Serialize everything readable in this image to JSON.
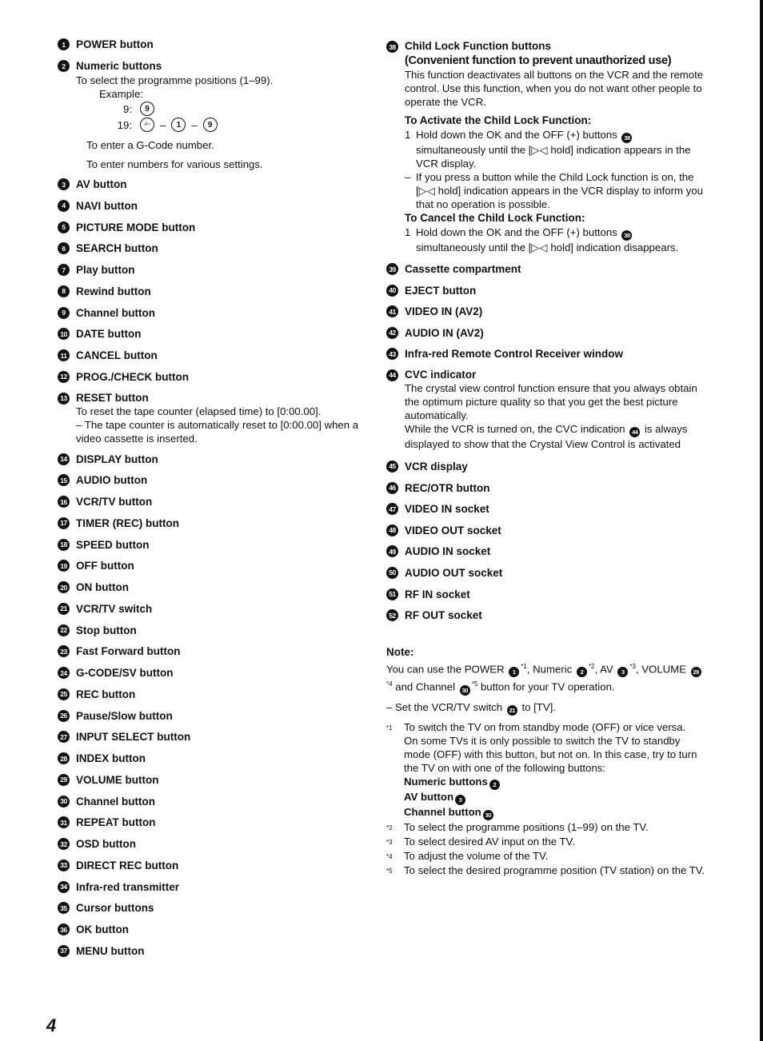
{
  "page_number": "4",
  "left_column": {
    "items_top": [
      {
        "num": "1",
        "label": "POWER button"
      },
      {
        "num": "2",
        "label": "Numeric buttons",
        "desc": "To select the programme positions (1–99).",
        "example_label": "Example:",
        "examples": [
          {
            "key": "9:",
            "sequence": [
              "9"
            ]
          },
          {
            "key": "19:",
            "sequence": [
              "-/--",
              "1",
              "9"
            ]
          }
        ],
        "extra": [
          "To enter a G-Code number.",
          "To enter numbers for various settings."
        ]
      }
    ],
    "items_mid": [
      {
        "num": "3",
        "label": "AV button"
      },
      {
        "num": "4",
        "label": "NAVI button"
      },
      {
        "num": "5",
        "label": "PICTURE MODE button"
      },
      {
        "num": "6",
        "label": "SEARCH button"
      },
      {
        "num": "7",
        "label": "Play button"
      },
      {
        "num": "8",
        "label": "Rewind button"
      },
      {
        "num": "9",
        "label": "Channel button"
      },
      {
        "num": "10",
        "label": "DATE button"
      },
      {
        "num": "11",
        "label": "CANCEL button"
      },
      {
        "num": "12",
        "label": "PROG./CHECK button"
      }
    ],
    "reset": {
      "num": "13",
      "label": "RESET button",
      "desc": "To reset the tape counter (elapsed time) to [0:00.00].",
      "note": "– The tape counter is automatically reset to [0:00.00] when a video cassette is inserted."
    },
    "items_bottom": [
      {
        "num": "14",
        "label": "DISPLAY button"
      },
      {
        "num": "15",
        "label": "AUDIO button"
      },
      {
        "num": "16",
        "label": "VCR/TV button"
      },
      {
        "num": "17",
        "label": "TIMER (REC) button"
      },
      {
        "num": "18",
        "label": "SPEED button"
      },
      {
        "num": "19",
        "label": "OFF button"
      },
      {
        "num": "20",
        "label": "ON button"
      },
      {
        "num": "21",
        "label": "VCR/TV switch"
      },
      {
        "num": "22",
        "label": "Stop button"
      },
      {
        "num": "23",
        "label": "Fast Forward button"
      },
      {
        "num": "24",
        "label": "G-CODE/SV button"
      },
      {
        "num": "25",
        "label": "REC button"
      },
      {
        "num": "26",
        "label": "Pause/Slow button"
      },
      {
        "num": "27",
        "label": "INPUT SELECT button"
      },
      {
        "num": "28",
        "label": "INDEX button"
      },
      {
        "num": "29",
        "label": "VOLUME button"
      },
      {
        "num": "30",
        "label": "Channel button"
      },
      {
        "num": "31",
        "label": "REPEAT button"
      },
      {
        "num": "32",
        "label": "OSD button"
      },
      {
        "num": "33",
        "label": "DIRECT REC button"
      },
      {
        "num": "34",
        "label": "Infra-red transmitter"
      },
      {
        "num": "35",
        "label": "Cursor buttons"
      },
      {
        "num": "36",
        "label": "OK button"
      },
      {
        "num": "37",
        "label": "MENU button"
      }
    ]
  },
  "right_column": {
    "child_lock": {
      "num": "38",
      "label": "Child Lock Function buttons",
      "subtitle": "(Convenient function to prevent unauthorized use)",
      "desc": "This function deactivates all buttons on the VCR and the remote control. Use this function, when you do not want other people to operate the VCR.",
      "activate_heading": "To Activate the Child Lock Function:",
      "activate_step_num": "1",
      "activate_step_pre": "Hold down the OK and the OFF (+) buttons",
      "activate_step_ref": "38",
      "activate_step_post": "simultaneously until the [▷◁ hold] indication appears in the VCR display.",
      "activate_note_mark": "–",
      "activate_note": "If you press a button while the Child Lock function is on, the [▷◁ hold] indication appears in the VCR display to inform you that no operation is possible.",
      "cancel_heading": "To Cancel the Child Lock Function:",
      "cancel_step_num": "1",
      "cancel_step_pre": "Hold down the OK and the OFF (+) buttons",
      "cancel_step_ref": "38",
      "cancel_step_post": "simultaneously until the [▷◁ hold] indication disappears."
    },
    "items": [
      {
        "num": "39",
        "label": "Cassette compartment"
      },
      {
        "num": "40",
        "label": "EJECT button"
      },
      {
        "num": "41",
        "label": "VIDEO IN (AV2)"
      },
      {
        "num": "42",
        "label": "AUDIO IN (AV2)"
      },
      {
        "num": "43",
        "label": "Infra-red Remote Control Receiver window"
      }
    ],
    "cvc": {
      "num": "44",
      "label": "CVC indicator",
      "desc1": "The crystal view control function ensure that you always obtain the optimum picture quality so that you get the best picture automatically.",
      "desc2_pre": "While the VCR is turned on, the CVC indication",
      "desc2_ref": "44",
      "desc2_post": "is always displayed to show that the Crystal View Control is activated"
    },
    "items2": [
      {
        "num": "45",
        "label": "VCR display"
      },
      {
        "num": "46",
        "label": "REC/OTR button"
      },
      {
        "num": "47",
        "label": "VIDEO IN socket"
      },
      {
        "num": "48",
        "label": "VIDEO OUT socket"
      },
      {
        "num": "49",
        "label": "AUDIO IN socket"
      },
      {
        "num": "50",
        "label": "AUDIO OUT socket"
      },
      {
        "num": "51",
        "label": "RF IN socket"
      },
      {
        "num": "52",
        "label": "RF OUT socket"
      }
    ],
    "note": {
      "title": "Note:",
      "line_a": "You can use the POWER",
      "ref_power": "1",
      "sup1": "*1",
      "line_b": ", Numeric",
      "ref_numeric": "2",
      "sup2": "*2",
      "line_c": ", AV",
      "ref_av": "3",
      "sup3": "*3",
      "line_d": ", VOLUME",
      "ref_volume": "29",
      "sup4": "*4",
      "line_e": "and Channel",
      "ref_channel": "30",
      "sup5": "*5",
      "line_f": "button for your TV operation.",
      "switch_pre": "– Set the VCR/TV switch",
      "switch_ref": "21",
      "switch_post": "to [TV].",
      "footnotes": [
        {
          "mark": "*1",
          "text": "To switch the TV on from standby mode (OFF) or vice versa.",
          "text2": "On some TVs it is only possible to switch the TV to standby mode (OFF) with this button, but not on. In this case, try to turn the TV on with one of the following buttons:",
          "buttons": [
            {
              "label": "Numeric buttons",
              "num": "2"
            },
            {
              "label": "AV button",
              "num": "3"
            },
            {
              "label": "Channel button",
              "num": "30"
            }
          ]
        },
        {
          "mark": "*2",
          "text": "To select the programme positions (1–99) on the TV."
        },
        {
          "mark": "*3",
          "text": "To select desired AV input on the TV."
        },
        {
          "mark": "*4",
          "text": "To adjust the volume of the TV."
        },
        {
          "mark": "*5",
          "text": "To select the desired programme position (TV station) on the TV."
        }
      ]
    }
  }
}
